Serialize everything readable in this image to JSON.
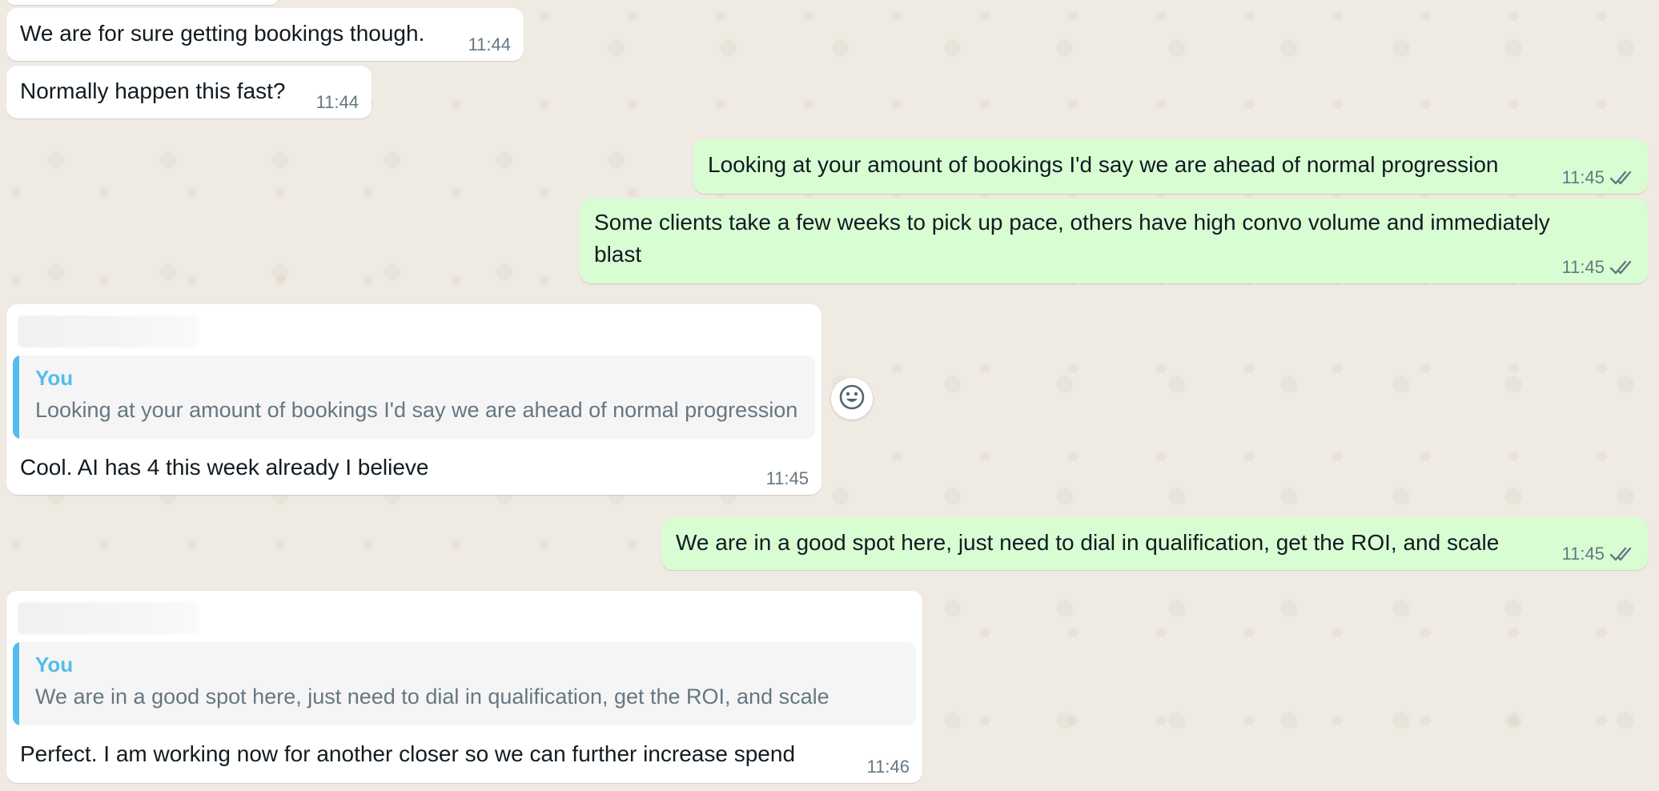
{
  "messages": [
    {
      "text": "We are for sure getting bookings though.",
      "time": "11:44"
    },
    {
      "text": "Normally happen this fast?",
      "time": "11:44"
    },
    {
      "text": "Looking at your amount of bookings I'd say we are ahead of normal progression",
      "time": "11:45"
    },
    {
      "text_line1": "Some clients take a few weeks to pick up pace, others have high convo volume and immediately",
      "text_line2": "blast",
      "time": "11:45"
    },
    {
      "quote_author": "You",
      "quote_text": "Looking at your amount of bookings I'd say we are ahead of normal progression",
      "text": "Cool.  AI has 4 this week already I believe",
      "time": "11:45"
    },
    {
      "text": "We are in a good spot here, just need to dial in qualification, get the ROI, and scale",
      "time": "11:45"
    },
    {
      "quote_author": "You",
      "quote_text": "We are in a good spot here, just need to dial in qualification, get the ROI, and scale",
      "text": "Perfect.  I am working now for another closer so we can further increase spend",
      "time": "11:46"
    }
  ],
  "icons": {
    "read_receipt": "double-check-icon",
    "reaction": "emoji-smile-icon"
  },
  "colors": {
    "incoming_bubble": "#ffffff",
    "outgoing_bubble": "#d9fdd3",
    "quote_accent": "#53bdeb",
    "chat_background": "#efeae2",
    "timestamp": "#667781"
  }
}
